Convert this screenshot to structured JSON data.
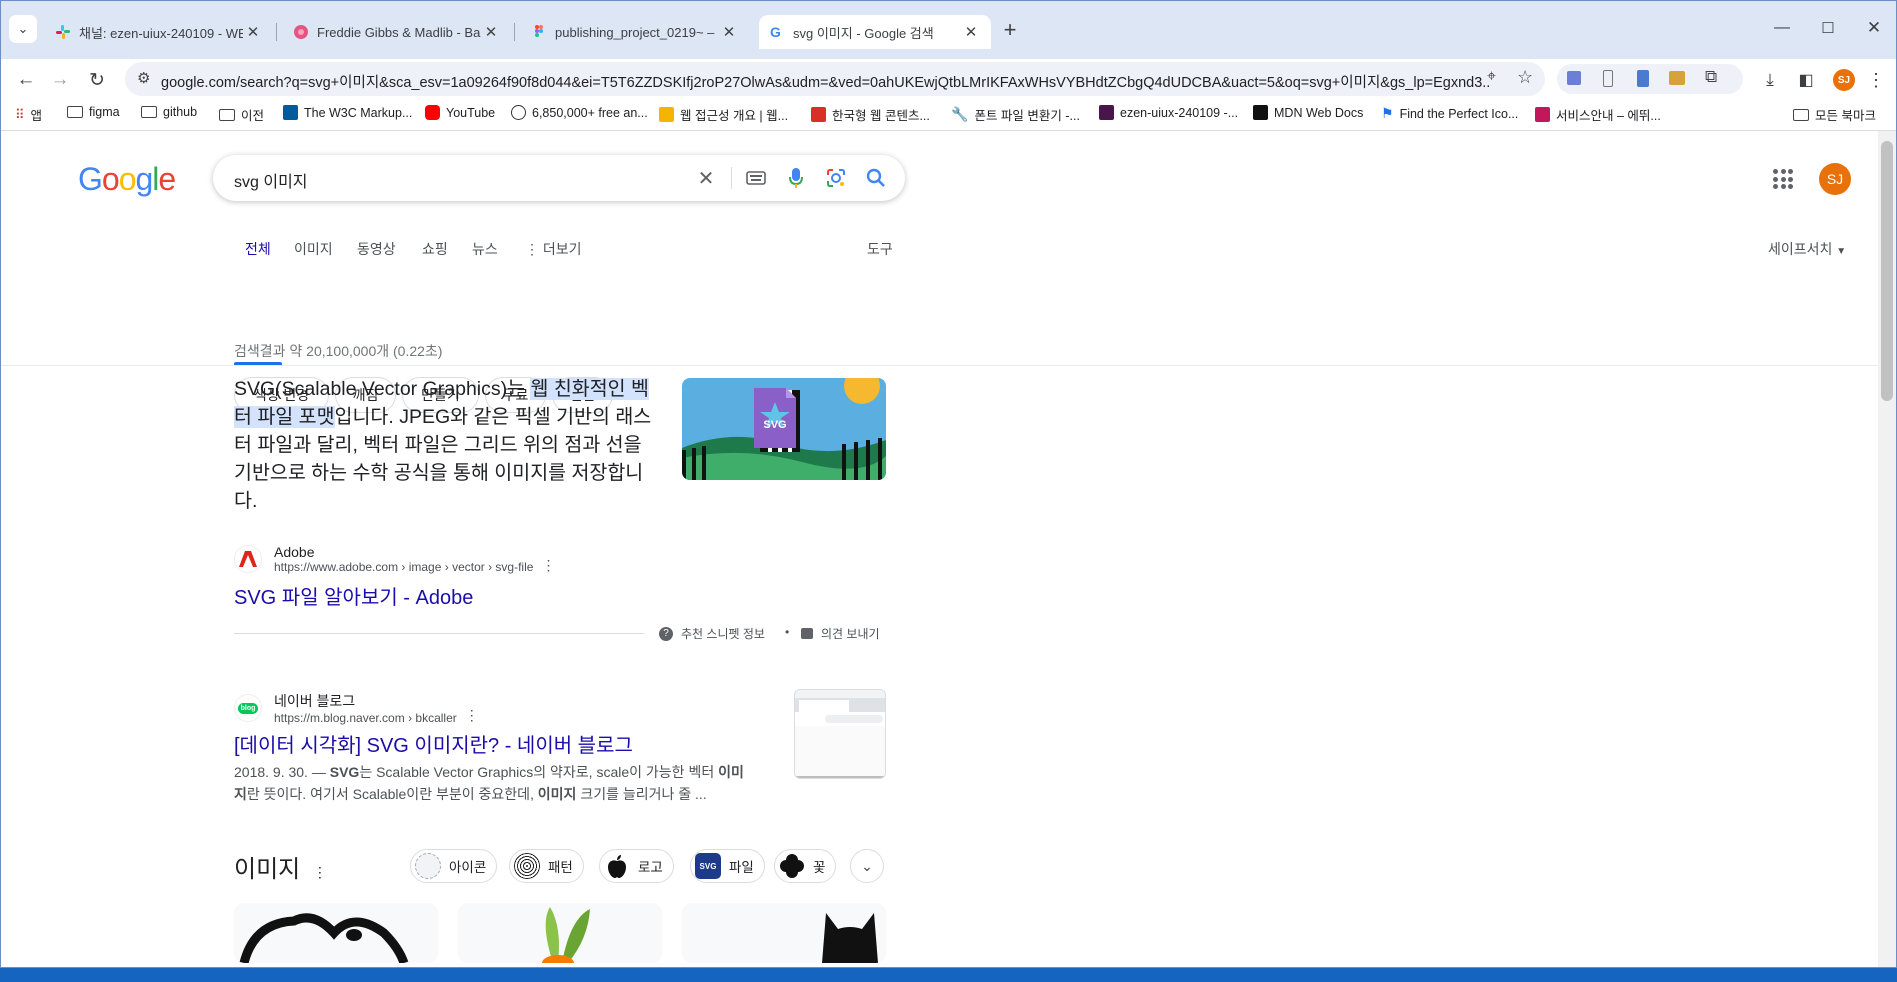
{
  "browser": {
    "tabs": [
      {
        "label": "채널: ezen-uiux-240109 - WEB",
        "active": false
      },
      {
        "label": "Freddie Gibbs & Madlib - Band",
        "active": false
      },
      {
        "label": "publishing_project_0219~ – Fi",
        "active": false
      },
      {
        "label": "svg 이미지 - Google 검색",
        "active": true
      }
    ],
    "url": "google.com/search?q=svg+이미지&sca_esv=1a09264f90f8d044&ei=T5T6ZZDSKIfj2roP27OlwAs&udm=&ved=0ahUKEwjQtbLMrIKFAxWHsVYBHdtZCbgQ4dUDCBA&uact=5&oq=svg+이미지&gs_lp=Egxnd3...",
    "profile_initials": "SJ",
    "bookmarks": [
      "앱",
      "figma",
      "github",
      "이전",
      "The W3C Markup...",
      "YouTube",
      "6,850,000+ free an...",
      "웹 접근성 개요 | 웹...",
      "한국형 웹 콘텐츠...",
      "폰트 파일 변환기 -...",
      "ezen-uiux-240109 -...",
      "MDN Web Docs",
      "Find the Perfect Ico...",
      "서비스안내 – 에뛰...",
      "모든 북마크"
    ]
  },
  "google": {
    "logo": "Google",
    "query": "svg 이미지",
    "avatar": "SJ",
    "nav_tabs": [
      "전체",
      "이미지",
      "동영상",
      "쇼핑",
      "뉴스",
      "더보기"
    ],
    "tools": "도구",
    "safesearch": "세이프서치",
    "chips": [
      "색상 변경",
      "깨짐",
      "만들기",
      "무료",
      "변환"
    ],
    "stats": "검색결과 약 20,100,000개 (0.22초)",
    "featured": {
      "text_pre": "SVG(Scalable Vector Graphics)는 ",
      "text_hl": "웹 친화적인 벡터 파일 포맷",
      "text_post": "입니다. JPEG와 같은 픽셀 기반의 래스터 파일과 달리, 벡터 파일은 그리드 위의 점과 선을 기반으로 하는 수학 공식을 통해 이미지를 저장합니다.",
      "img_label": "SVG",
      "source_name": "Adobe",
      "source_url": "https://www.adobe.com › image › vector › svg-file",
      "title": "SVG 파일 알아보기 - Adobe",
      "about": "추천 스니펫 정보",
      "feedback": "의견 보내기"
    },
    "result2": {
      "source_name": "네이버 블로그",
      "source_url": "https://m.blog.naver.com › bkcaller",
      "favicon_text": "blog",
      "title": "[데이터 시각화] SVG 이미지란? - 네이버 블로그",
      "date": "2018. 9. 30. — ",
      "snippet_parts": [
        "SVG",
        "는 Scalable Vector Graphics의 약자로, scale이 가능한 벡터 ",
        "이미지",
        "란 뜻이다. 여기서 Scalable이란 부분이 중요한데, ",
        "이미지",
        " 크기를 늘리거나 줄 ..."
      ]
    },
    "images_heading": "이미지",
    "image_chips": [
      "아이콘",
      "패턴",
      "로고",
      "파일",
      "꽃"
    ],
    "image_chip_file_icon": "SVG"
  }
}
